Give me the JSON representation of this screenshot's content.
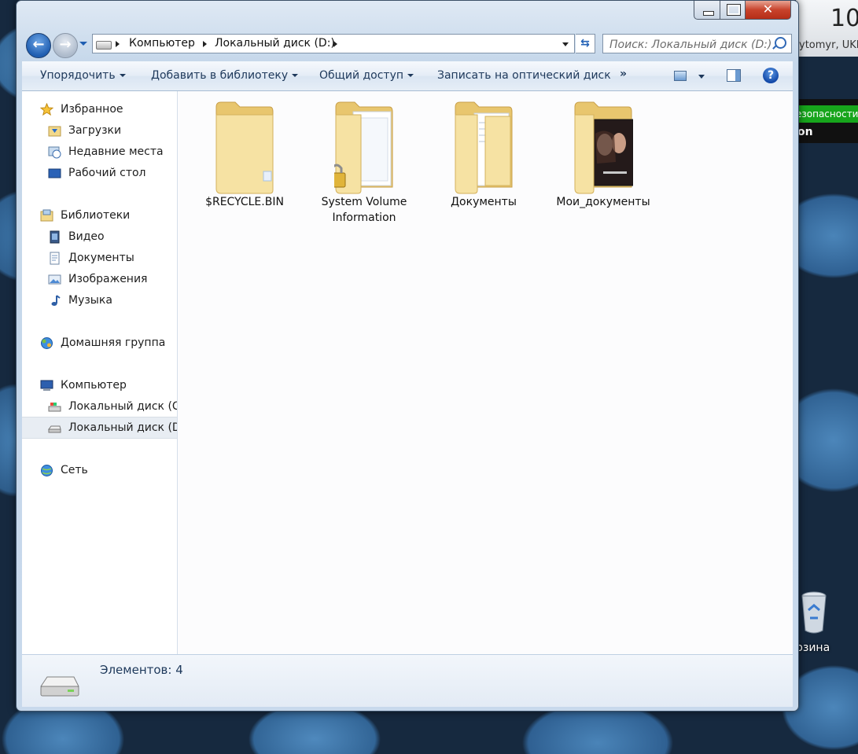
{
  "desktop": {
    "clock_time": "10",
    "clock_city": "ytomyr, UKR",
    "av_status": "езопасности",
    "av_brand": "on",
    "recycle_label": "рзина"
  },
  "window": {
    "close_glyph": "✕",
    "address": {
      "crumbs": [
        "Компьютер",
        "Локальный диск (D:)"
      ]
    },
    "search": {
      "placeholder": "Поиск: Локальный диск (D:)"
    },
    "toolbar": {
      "organize": "Упорядочить",
      "add_library": "Добавить в библиотеку",
      "share": "Общий доступ",
      "burn": "Записать на оптический диск",
      "more": "»",
      "help": "?"
    },
    "nav": {
      "favorites": "Избранное",
      "downloads": "Загрузки",
      "recent": "Недавние места",
      "desktop": "Рабочий стол",
      "libraries": "Библиотеки",
      "video": "Видео",
      "documents": "Документы",
      "pictures": "Изображения",
      "music": "Музыка",
      "homegroup": "Домашняя группа",
      "computer": "Компьютер",
      "drive_c": "Локальный диск (C:)",
      "drive_d": "Локальный диск (D:)",
      "network": "Сеть"
    },
    "files": [
      {
        "name": "$RECYCLE.BIN",
        "type": "folder-empty"
      },
      {
        "name": "System Volume Information",
        "type": "folder-locked"
      },
      {
        "name": "Документы",
        "type": "folder-docs"
      },
      {
        "name": "Мои_документы",
        "type": "folder-image"
      }
    ],
    "details": {
      "count": "Элементов: 4"
    }
  },
  "colors": {
    "accent": "#1e395b",
    "folder": "#f3d98b"
  }
}
